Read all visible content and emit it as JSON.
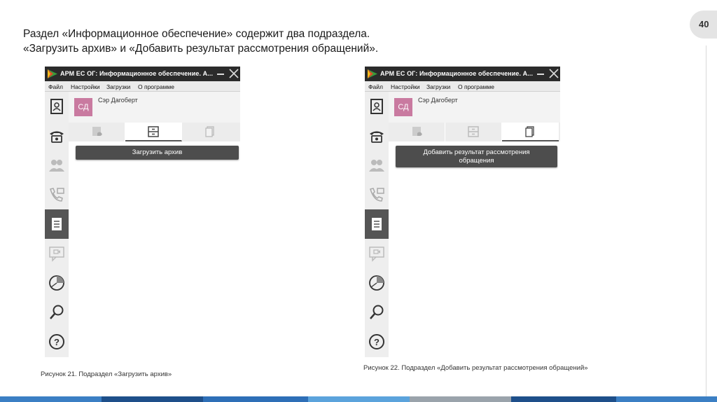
{
  "slide_number": "40",
  "heading": {
    "line1": "Раздел «Информационное обеспечение» содержит два подраздела.",
    "line2": "«Загрузить архив» и «Добавить результат рассмотрения обращений»."
  },
  "window": {
    "title": "АРМ ЕС ОГ: Информационное обеспечение. А...",
    "menu": [
      "Файл",
      "Настройки",
      "Загрузки",
      "О программе"
    ],
    "avatar_initials": "СД",
    "user_name": "Сэр Дагоберт",
    "sidebar_icons": [
      "contact-card-icon",
      "phone-icon",
      "users-icon",
      "call-message-icon",
      "document-icon",
      "video-message-icon",
      "pie-chart-icon",
      "search-icon",
      "help-icon"
    ]
  },
  "left": {
    "button_label": "Загрузить архив",
    "caption": "Рисунок 21. Подраздел «Загрузить архив»"
  },
  "right": {
    "button_line1": "Добавить результат рассмотрения",
    "button_line2": "обращения",
    "caption": "Рисунок 22. Подраздел «Добавить результат рассмотрения обращений»"
  },
  "colors": {
    "titlebar": "#2b2b2b",
    "active_sidebar": "#555555",
    "button": "#4d4d4d",
    "avatar": "#c97aa0",
    "bottom_bar": [
      "#3b7fc4",
      "#1e4f8a",
      "#2e6fb7",
      "#5ba3dc",
      "#9aa3ab",
      "#1e4f8a",
      "#3b7fc4"
    ]
  }
}
